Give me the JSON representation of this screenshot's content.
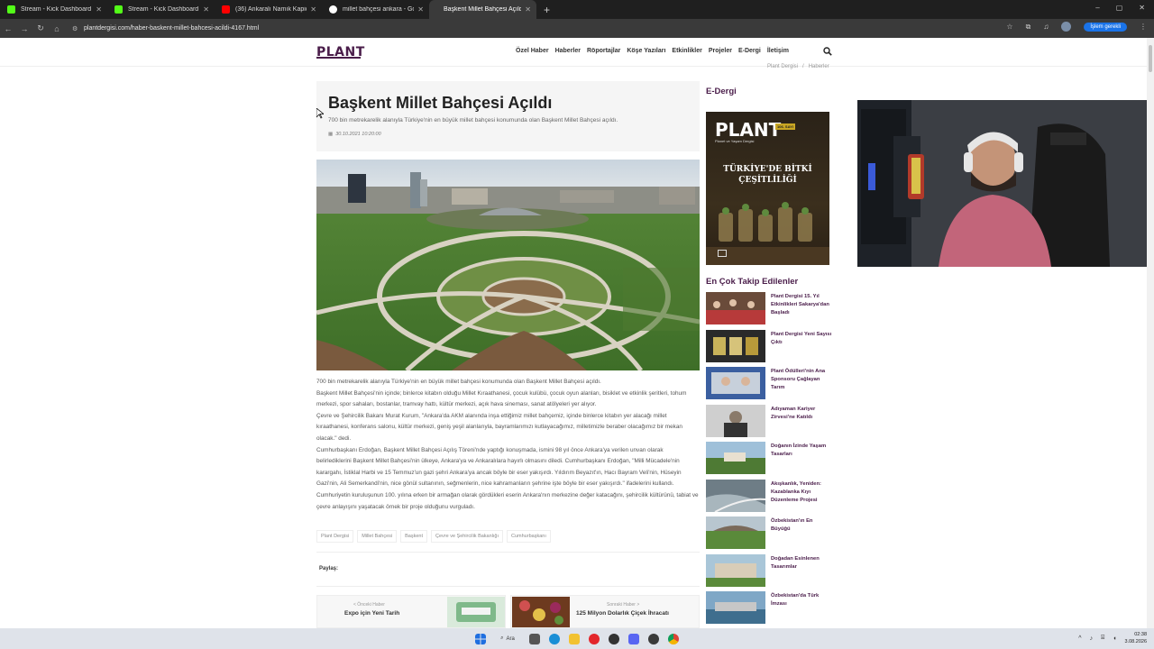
{
  "browser": {
    "tabs": [
      {
        "title": "Stream - Kick Dashboard",
        "favicon_color": "#53fc18",
        "active": false
      },
      {
        "title": "Stream - Kick Dashboard",
        "favicon_color": "#53fc18",
        "active": false
      },
      {
        "title": "(36) Ankaralı Namık Kapici Izzet...",
        "favicon_color": "#ff0000",
        "active": false
      },
      {
        "title": "millet bahçesi ankara - Google ...",
        "favicon_color": "#ffffff",
        "active": false
      },
      {
        "title": "Başkent Millet Bahçesi Açıldı",
        "favicon_color": "#3a3a3a",
        "active": true
      }
    ],
    "new_tab": "+",
    "window_controls": [
      "–",
      "▢",
      "✕"
    ],
    "url": "plantdergisi.com/haber-baskent-millet-bahcesi-acildi-4167.html",
    "update_button": "İşlem gerekli"
  },
  "site": {
    "logo": "PLANT",
    "nav": [
      "Özel Haber",
      "Haberler",
      "Röportajlar",
      "Köşe Yazıları",
      "Etkinlikler",
      "Projeler",
      "E-Dergi",
      "İletişim"
    ],
    "breadcrumb": [
      "Plant Dergisi",
      "/",
      "Haberler"
    ]
  },
  "article": {
    "title": "Başkent Millet Bahçesi Açıldı",
    "subtitle": "700 bin metrekarelik alanıyla Türkiye'nin en büyük millet bahçesi konumunda olan Başkent Millet Bahçesi açıldı.",
    "date": "30.10.2021 10:20:00",
    "paragraphs": [
      "700 bin metrekarelik alanıyla Türkiye'nin en büyük millet bahçesi konumunda olan Başkent Millet Bahçesi açıldı.",
      "Başkent Millet Bahçesi'nin içinde; binlerce kitabın olduğu Millet Kıraathanesi, çocuk kulübü, çocuk oyun alanları, bisiklet ve etkinlik şeritleri, tohum merkezi, spor sahaları, bostanlar, tramvay hattı, kültür merkezi, açık hava sineması, sanat atölyeleri yer alıyor.",
      "Çevre ve Şehircilik Bakanı Murat Kurum, \"Ankara'da AKM alanında inşa ettiğimiz millet bahçemiz, içinde binlerce kitabın yer alacağı millet kıraathanesi, konferans salonu, kültür merkezi, geniş yeşil alanlarıyla, bayramlarımızı kutlayacağımız, milletimizle beraber olacağımız bir mekan olacak.\" dedi.",
      "Cumhurbaşkanı Erdoğan, Başkent Millet Bahçesi Açılış Töreni'nde yaptığı konuşmada, ismini 98 yıl önce Ankara'ya verilen unvan olarak belirlediklerini Başkent Millet Bahçesi'nin ülkeye, Ankara'ya ve Ankaralılara hayırlı olmasını diledi. Cumhurbaşkanı Erdoğan, \"Milli Mücadele'nin karargahı, İstiklal Harbi ve 15 Temmuz'un gazi şehri Ankara'ya ancak böyle bir eser yakışırdı. Yıldırım Beyazıt'ın, Hacı Bayram Veli'nin, Hüseyin Gazi'nin, Ali Semerkandi'nin, nice gönül sultanının, seğmenlerin, nice kahramanların şehrine işte böyle bir eser yakışırdı.\" ifadelerini kullandı. Cumhuriyetin kuruluşunun 100. yılına erken bir armağan olarak gördükleri eserin Ankara'nın merkezine değer katacağını, şehircilik kültürünü, tabiat ve çevre anlayışını yaşatacak örnek bir proje olduğunu vurguladı."
    ],
    "tags": [
      "Plant Dergisi",
      "Millet Bahçesi",
      "Başkent",
      "Çevre ve Şehircilik Bakanlığı",
      "Cumhurbaşkanı"
    ],
    "share_label": "Paylaş:",
    "prev": {
      "label": "< Önceki Haber",
      "title": "Expo için Yeni Tarih"
    },
    "next": {
      "label": "Sonraki Haber >",
      "title": "125 Milyon Dolarlık Çiçek İhracatı"
    }
  },
  "sidebar": {
    "edergi_heading": "E-Dergi",
    "cover": {
      "logo": "PLANT",
      "badge": "106. SAYI",
      "title": "TÜRKİYE'DE BİTKİ ÇEŞİTLİLİĞİ",
      "tagline": "Planet ve Yaşam Dergisi"
    },
    "follow_heading": "En Çok Takip Edilenler",
    "items": [
      {
        "title": "Plant Dergisi 15. Yıl Etkinlikleri Sakarya'dan Başladı"
      },
      {
        "title": "Plant Dergisi Yeni Sayısı Çıktı"
      },
      {
        "title": "Plant Ödülleri'nin Ana Sponsoru Çağlayan Tarım"
      },
      {
        "title": "Adıyaman Kariyer Zirvesi'ne Katıldı"
      },
      {
        "title": "Doğanın İzinde Yaşam Tasarları"
      },
      {
        "title": "Akışkanlık, Yeniden: Kazablanka Kıyı Düzenleme Projesi"
      },
      {
        "title": "Özbekistan'ın En Büyüğü"
      },
      {
        "title": "Doğadan Esinlenen Tasarımlar"
      },
      {
        "title": "Özbekistan'da Türk İmzası"
      }
    ]
  },
  "taskbar": {
    "search_label": "Ara",
    "time": "02:38",
    "date": "3.08.2026"
  }
}
